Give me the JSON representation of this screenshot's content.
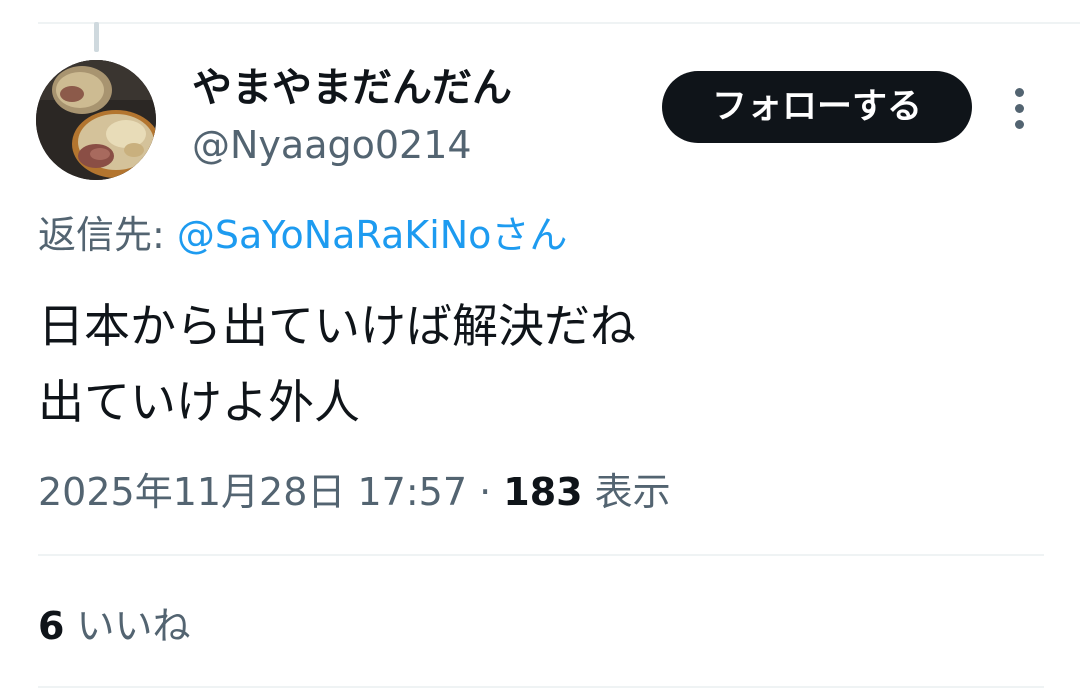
{
  "author": {
    "display_name": "やまやまだんだん",
    "handle": "@Nyaago0214",
    "avatar_icon": "ramen-bowl-avatar"
  },
  "follow_button": {
    "label": "フォローする"
  },
  "more_menu_icon": "vertical-ellipsis-icon",
  "reply": {
    "prefix": "返信先: ",
    "target": "@SaYoNaRaKiNoさん"
  },
  "tweet": {
    "lines": [
      "日本から出ていけば解決だね",
      "出ていけよ外人"
    ]
  },
  "meta": {
    "timestamp": "2025年11月28日 17:57",
    "separator": " · ",
    "views_count": "183",
    "views_label": " 表示"
  },
  "engagement": {
    "likes_count": "6",
    "likes_label": " いいね"
  },
  "colors": {
    "text_primary": "#0f1419",
    "text_secondary": "#536471",
    "link": "#1d9bf0",
    "divider": "#eff3f4",
    "follow_bg": "#0f1419"
  }
}
